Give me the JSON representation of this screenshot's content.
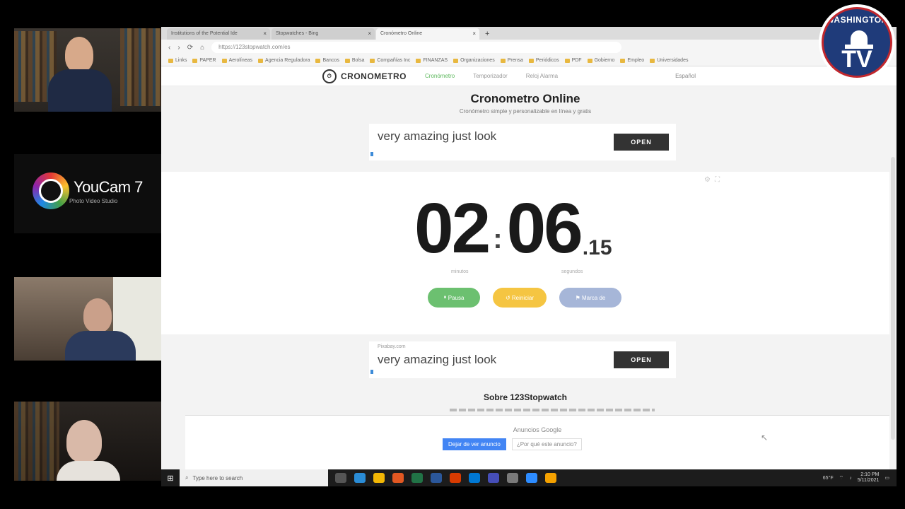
{
  "overlay": {
    "logo_line1": "WASHINGTON",
    "logo_line2": "TV"
  },
  "youcam": {
    "name": "YouCam 7",
    "sub": "Photo Video Studio"
  },
  "browser": {
    "tabs": [
      {
        "label": "Institutions of the Potential Ide"
      },
      {
        "label": "Stopwatches - Bing"
      },
      {
        "label": "Cronómetro Online"
      }
    ],
    "new_tab": "+",
    "address": "https://123stopwatch.com/es",
    "bookmarks": [
      "Links",
      "PAPER",
      "Aerolíneas",
      "Agencia Reguladora",
      "Bancos",
      "Bolsa",
      "Compañías Inc",
      "FINANZAS",
      "Organizaciones",
      "Prensa",
      "Periódicos",
      "PDF",
      "Gobierno",
      "Empleo",
      "Universidades"
    ]
  },
  "site": {
    "brand": "CRONOMETRO",
    "nav": [
      "Cronómetro",
      "Temporizador",
      "Reloj Alarma"
    ],
    "language": "Español"
  },
  "page": {
    "title": "Cronometro Online",
    "subtitle": "Cronómetro simple y personalizable en línea y gratis",
    "ad_text": "very amazing just look",
    "ad_sponsor": "Pixabay.com",
    "ad_button": "OPEN",
    "about_title": "Sobre 123Stopwatch",
    "ads_by": "Anuncios Google",
    "ads_btn1": "Dejar de ver anuncio",
    "ads_btn2": "¿Por qué este anuncio?"
  },
  "timer": {
    "minutes": "02",
    "seconds": "06",
    "hundredths": ".15",
    "minutes_label": "minutos",
    "seconds_label": "segundos",
    "pause_label": "Pausa",
    "reset_label": "Reiniciar",
    "lap_label": "Marca de"
  },
  "taskbar": {
    "search_placeholder": "Type here to search",
    "temp": "65°F",
    "time": "2:10 PM",
    "date": "5/11/2021"
  }
}
